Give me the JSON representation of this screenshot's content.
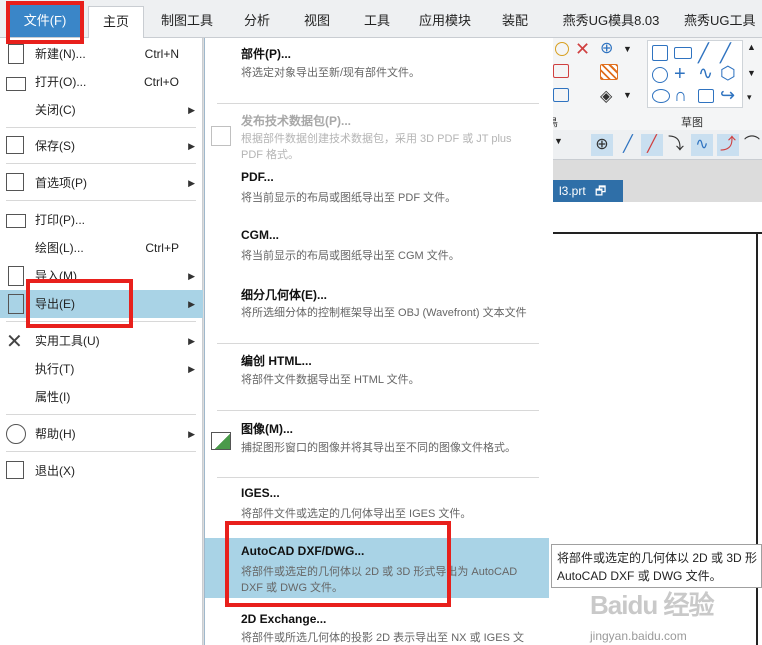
{
  "tabs": [
    {
      "label": "文件(F)"
    },
    {
      "label": "主页"
    },
    {
      "label": "制图工具"
    },
    {
      "label": "分析"
    },
    {
      "label": "视图"
    },
    {
      "label": "工具"
    },
    {
      "label": "应用模块"
    },
    {
      "label": "装配"
    },
    {
      "label": "燕秀UG模具8.03"
    },
    {
      "label": "燕秀UG工具"
    }
  ],
  "ribbon": {
    "sketch_group_label": "草图",
    "left_group_fragment": "鳥"
  },
  "graphics_tab": {
    "label": "l3.prt",
    "close": "✕",
    "doc_glyph": "🗗"
  },
  "file_menu": {
    "items": [
      {
        "label": "新建(N)...",
        "shortcut": "Ctrl+N"
      },
      {
        "label": "打开(O)...",
        "shortcut": "Ctrl+O"
      },
      {
        "label": "关闭(C)",
        "arrow": "▶"
      },
      {
        "label": "保存(S)",
        "arrow": "▶"
      },
      {
        "label": "首选项(P)",
        "arrow": "▶"
      },
      {
        "label": "打印(P)..."
      },
      {
        "label": "绘图(L)...",
        "shortcut": "Ctrl+P"
      },
      {
        "label": "导入(M)",
        "arrow": "▶"
      },
      {
        "label": "导出(E)",
        "arrow": "▶"
      },
      {
        "label": "实用工具(U)",
        "arrow": "▶"
      },
      {
        "label": "执行(T)",
        "arrow": "▶"
      },
      {
        "label": "属性(I)"
      },
      {
        "label": "帮助(H)",
        "arrow": "▶"
      },
      {
        "label": "退出(X)"
      }
    ]
  },
  "export_menu": {
    "items": [
      {
        "title": "部件(P)...",
        "desc": "将选定对象导出至新/现有部件文件。"
      },
      {
        "title": "发布技术数据包(P)...",
        "desc": "根据部件数据创建技术数据包，采用 3D PDF 或 JT plus PDF 格式。"
      },
      {
        "title": "PDF...",
        "desc": "将当前显示的布局或图纸导出至 PDF 文件。"
      },
      {
        "title": "CGM...",
        "desc": "将当前显示的布局或图纸导出至 CGM 文件。"
      },
      {
        "title": "细分几何体(E)...",
        "desc": "将所选细分体的控制框架导出至 OBJ (Wavefront) 文本文件"
      },
      {
        "title": "编创 HTML...",
        "desc": "将部件文件数据导出至 HTML 文件。"
      },
      {
        "title": "图像(M)...",
        "desc": "捕捉图形窗口的图像并将其导出至不同的图像文件格式。"
      },
      {
        "title": "IGES...",
        "desc": "将部件文件或选定的几何体导出至 IGES 文件。"
      },
      {
        "title": "AutoCAD DXF/DWG...",
        "desc": "将部件或选定的几何体以 2D 或 3D 形式导出为 AutoCAD DXF 或 DWG 文件。"
      },
      {
        "title": "2D Exchange...",
        "desc": "将部件或所选几何体的投影 2D 表示导出至 NX 或 IGES 文"
      }
    ]
  },
  "tooltip": {
    "line1": "将部件或选定的几何体以 2D 或 3D 形",
    "line2": "AutoCAD DXF 或 DWG 文件。"
  },
  "watermark": {
    "logo": "Baidu 经验",
    "url": "jingyan.baidu.com"
  },
  "colors": {
    "file_tab": "#3a86c8",
    "highlight": "#a9d3e6",
    "callout": "#e8201c",
    "icon_blue": "#2f73c0"
  }
}
